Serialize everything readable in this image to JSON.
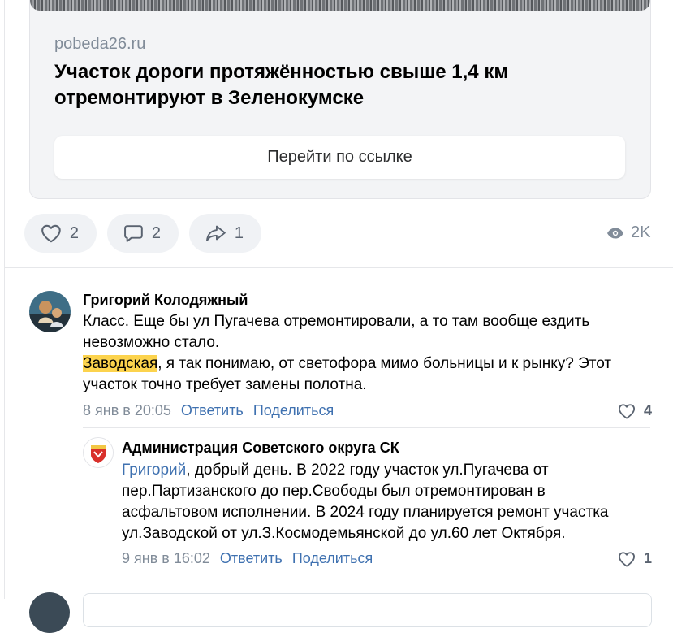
{
  "link_card": {
    "domain": "pobeda26.ru",
    "title": "Участок дороги протяжённостью свыше 1,4 км отремонтируют в Зеленокумске",
    "button_label": "Перейти по ссылке"
  },
  "post_actions": {
    "likes": "2",
    "comments": "2",
    "shares": "1",
    "views": "2K"
  },
  "comments": [
    {
      "author": "Григорий Колодяжный",
      "paragraph1": "Класс. Еще бы ул Пугачева отремонтировали, а то там вообще ездить невозможно стало.",
      "mention": "Заводская",
      "paragraph2_rest": ", я так понимаю, от светофора мимо больницы и к рынку? Этот участок точно требует замены полотна.",
      "date": "8 янв в 20:05",
      "reply_label": "Ответить",
      "share_label": "Поделиться",
      "likes": "4"
    },
    {
      "author": "Администрация Советского округа СК",
      "mention": "Григорий",
      "text_rest": ", добрый день. В 2022 году участок ул.Пугачева от пер.Партизанского до пер.Свободы был отремонтирован в асфальтовом исполнении. В 2024 году планируется ремонт участка ул.Заводской от ул.З.Космодемьянской до ул.60 лет Октября.",
      "date": "9 янв в 16:02",
      "reply_label": "Ответить",
      "share_label": "Поделиться",
      "likes": "1"
    }
  ],
  "icons": [
    "heart-icon",
    "comment-icon",
    "share-icon",
    "eye-icon"
  ],
  "colors": {
    "accent": "#3f71b0",
    "mention_highlight": "#fcd34d",
    "secondary_text": "#818c99"
  }
}
